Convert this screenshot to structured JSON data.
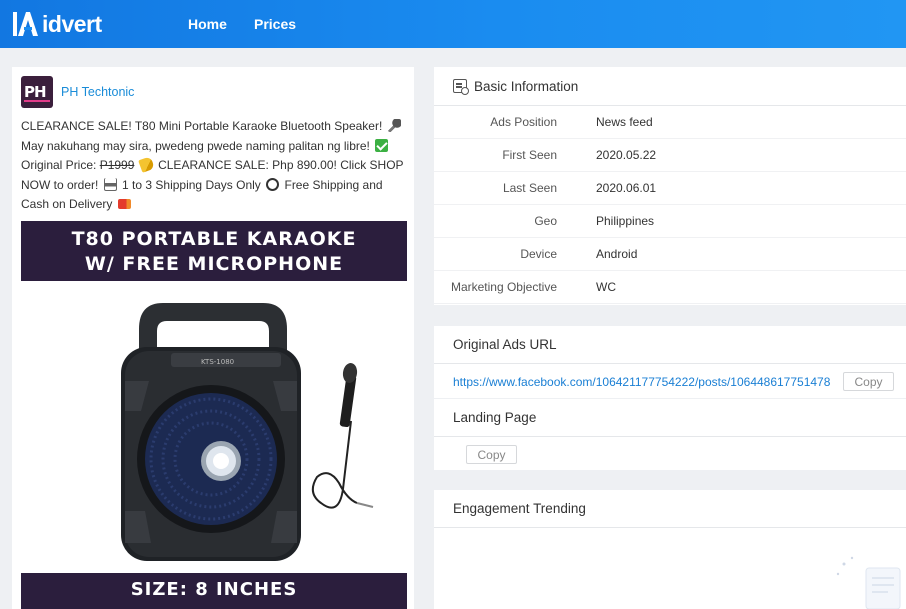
{
  "brand": {
    "name": "idvert",
    "mark": "A"
  },
  "nav": {
    "home": "Home",
    "prices": "Prices"
  },
  "ad": {
    "advertiser": "PH Techtonic",
    "avatar_text": "PH",
    "text_parts": {
      "p1": "CLEARANCE SALE! T80 Mini Portable Karaoke Bluetooth Speaker!",
      "p2": "May nakuhang may sira, pwedeng pwede naming palitan ng libre!",
      "p3": "Original Price:",
      "p4": "P1999",
      "p5": "CLEARANCE SALE: Php 890.00! Click SHOP NOW to order!",
      "p6": "1 to 3 Shipping Days Only",
      "p7": "Free Shipping and Cash on Delivery"
    },
    "image": {
      "banner_line1": "T80 PORTABLE KARAOKE",
      "banner_line2": "W/ FREE MICROPHONE",
      "bottom_text": "SIZE: 8 INCHES",
      "model_label": "KTS-1080"
    }
  },
  "basic": {
    "title": "Basic Information",
    "rows": [
      {
        "key": "Ads Position",
        "value": "News feed"
      },
      {
        "key": "First Seen",
        "value": "2020.05.22"
      },
      {
        "key": "Last Seen",
        "value": "2020.06.01"
      },
      {
        "key": "Geo",
        "value": "Philippines"
      },
      {
        "key": "Device",
        "value": "Android"
      },
      {
        "key": "Marketing Objective",
        "value": "WC"
      }
    ]
  },
  "original_url": {
    "title": "Original Ads URL",
    "url": "https://www.facebook.com/106421177754222/posts/106448617751478",
    "copy": "Copy"
  },
  "landing": {
    "title": "Landing Page",
    "copy": "Copy"
  },
  "engagement": {
    "title": "Engagement Trending"
  },
  "colors": {
    "nav": "#1a8cf0",
    "link": "#1a7fd4",
    "banner": "#2b1e3d"
  }
}
